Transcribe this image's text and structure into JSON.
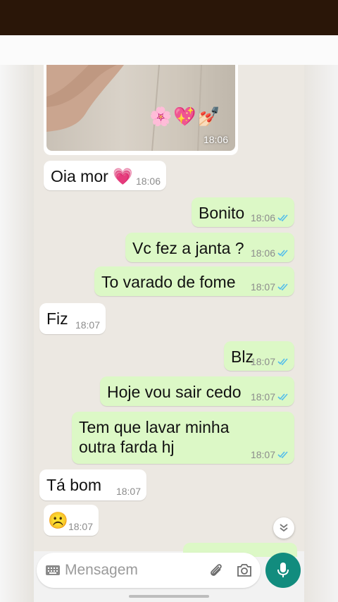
{
  "messages": [
    {
      "text": "Oia mor 💗",
      "time": "18:06",
      "dir": "in"
    },
    {
      "text": "Bonito",
      "time": "18:06",
      "dir": "out"
    },
    {
      "text": "Vc fez a janta ?",
      "time": "18:06",
      "dir": "out"
    },
    {
      "text": "To varado de fome",
      "time": "18:07",
      "dir": "out"
    },
    {
      "text": "Fiz",
      "time": "18:07",
      "dir": "in"
    },
    {
      "text": "Blz",
      "time": "18:07",
      "dir": "out"
    },
    {
      "text": "Hoje vou sair cedo",
      "time": "18:07",
      "dir": "out"
    },
    {
      "text": "Tem que lavar minha",
      "text2": "outra farda hj",
      "time": "18:07",
      "dir": "out"
    },
    {
      "text": "Tá bom",
      "time": "18:07",
      "dir": "in"
    },
    {
      "text": "☹️",
      "time": "18:07",
      "dir": "in"
    }
  ],
  "image_message": {
    "time": "18:06",
    "emojis": "🌸💖💅🏻"
  },
  "composer": {
    "placeholder": "Mensagem"
  },
  "colors": {
    "incoming": "#ffffff",
    "outgoing": "#dcf8c6",
    "accent": "#128c7e",
    "read_tick": "#53bdeb"
  }
}
